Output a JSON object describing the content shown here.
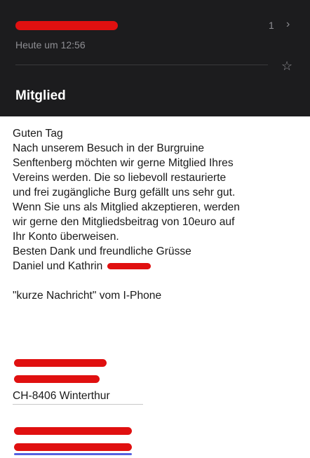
{
  "header": {
    "counter": "1",
    "chevron": "›",
    "time": "Heute um 12:56",
    "subject": "Mitglied"
  },
  "message": {
    "greeting": "Guten Tag",
    "lines": [
      "Nach unserem Besuch in der Burgruine",
      "Senftenberg möchten wir gerne Mitglied Ihres",
      "Vereins werden. Die so liebevoll restaurierte",
      "und frei zugängliche Burg gefällt uns sehr gut.",
      "Wenn Sie uns als Mitglied akzeptieren, werden",
      "wir gerne den Mitgliedsbeitrag von 10euro auf",
      "Ihr Konto überweisen.",
      "Besten Dank und freundliche Grüsse"
    ],
    "signature": "Daniel und Kathrin",
    "footer_note": "\"kurze Nachricht\" vom I-Phone",
    "city": "CH-8406 Winterthur"
  },
  "icons": {
    "star": "star-icon",
    "chevron": "chevron-right-icon"
  },
  "colors": {
    "header_bg": "#1c1c1e",
    "redaction": "#e01010",
    "muted": "#8e8e93"
  }
}
